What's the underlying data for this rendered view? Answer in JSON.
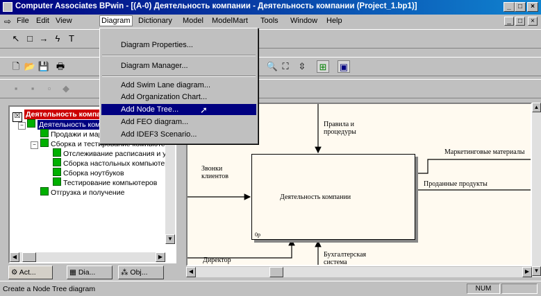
{
  "window": {
    "title": "Computer Associates BPwin - [(A-0) Деятельность компании - Деятельность компании  (Project_1.bp1)]",
    "controls": {
      "minimize": "_",
      "maximize": "□",
      "close": "×"
    }
  },
  "menubar": {
    "items": [
      "File",
      "Edit",
      "View",
      "Diagram",
      "Dictionary",
      "Model",
      "ModelMart",
      "Tools",
      "Window",
      "Help"
    ],
    "active": "Diagram"
  },
  "diagram_menu": {
    "items": [
      {
        "label": "Diagram Properties..."
      },
      {
        "label": "Diagram Manager..."
      },
      {
        "label": "Add Swim Lane diagram..."
      },
      {
        "label": "Add Organization Chart..."
      },
      {
        "label": "Add Node Tree...",
        "highlighted": true
      },
      {
        "label": "Add FEO diagram..."
      },
      {
        "label": "Add IDEF3 Scenario..."
      }
    ]
  },
  "tree": {
    "root": "Деятельность компании",
    "selected": "Деятельность компании",
    "items": [
      {
        "label": "Продажи и маркетинг",
        "level": 2
      },
      {
        "label": "Сборка и тестирование компьютеров",
        "level": 2
      },
      {
        "label": "Отслеживание расписания и управление ресурсами",
        "level": 3
      },
      {
        "label": "Сборка настольных компьютеров",
        "level": 3
      },
      {
        "label": "Сборка ноутбуков",
        "level": 3
      },
      {
        "label": "Тестирование компьютеров",
        "level": 3
      },
      {
        "label": "Отгрузка и получение",
        "level": 2
      }
    ]
  },
  "panel_tabs": [
    "Act...",
    "Dia...",
    "Obj..."
  ],
  "diagram": {
    "box_label": "Деятельность компании",
    "box_number": "0р",
    "arrows": {
      "control": "Правила и процедуры",
      "input": "Звонки клиентов",
      "output1": "Маркетинговые материалы",
      "output2": "Проданные продукты",
      "mechanism1": "Директор",
      "mechanism2": "Бухгалтерская система"
    }
  },
  "status": {
    "text": "Create a Node Tree diagram",
    "num": "NUM"
  },
  "colors": {
    "titlebar": "#000080",
    "highlight": "#000080",
    "tree_root_bg": "#cc0000",
    "diagram_bg": "#fffaf0",
    "tree_node": "#00b000"
  }
}
